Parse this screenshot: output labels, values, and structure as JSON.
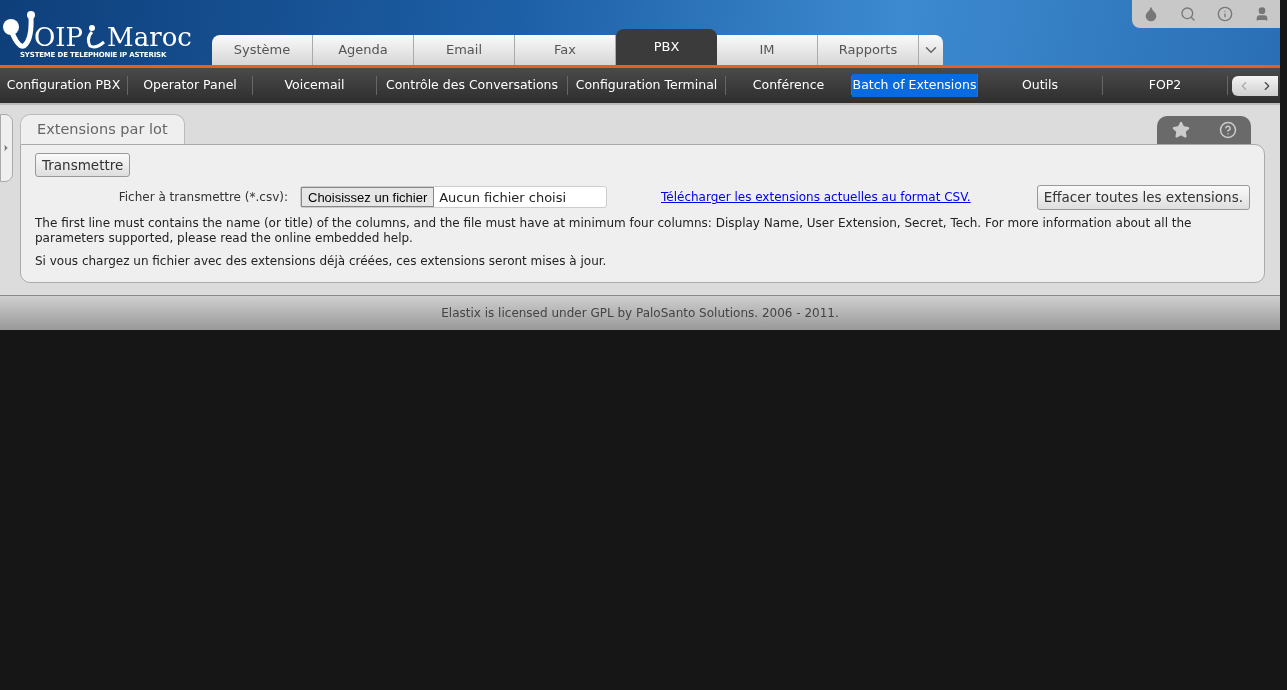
{
  "logo": {
    "brand": "OIP",
    "brand_suffix": "Maroc",
    "tagline": "SYSTEME DE TELEPHONIE IP ASTERISK"
  },
  "tabs": [
    {
      "label": "Système",
      "selected": false
    },
    {
      "label": "Agenda",
      "selected": false
    },
    {
      "label": "Email",
      "selected": false
    },
    {
      "label": "Fax",
      "selected": false
    },
    {
      "label": "PBX",
      "selected": true
    },
    {
      "label": "IM",
      "selected": false
    },
    {
      "label": "Rapports",
      "selected": false
    }
  ],
  "submenu": [
    {
      "label": "Configuration PBX",
      "selected": false
    },
    {
      "label": "Operator Panel",
      "selected": false
    },
    {
      "label": "Voicemail",
      "selected": false
    },
    {
      "label": "Contrôle des Conversations",
      "selected": false
    },
    {
      "label": "Configuration Terminal",
      "selected": false
    },
    {
      "label": "Conférence",
      "selected": false
    },
    {
      "label": "Batch of Extensions",
      "selected": true
    },
    {
      "label": "Outils",
      "selected": false
    },
    {
      "label": "FOP2",
      "selected": false
    }
  ],
  "panel": {
    "title": "Extensions par lot",
    "submit_button": "Transmettre",
    "file_label": "Ficher à transmettre (*.csv):",
    "file_button": "Choisissez un fichier",
    "file_status": "Aucun fichier choisi",
    "download_link": "Télécharger les extensions actuelles au format CSV.",
    "clear_button": "Effacer toutes les extensions.",
    "info_text": "The first line must contains the name (or title) of the columns, and the file must have at minimum four columns: Display Name, User Extension, Secret, Tech. For more information about all the parameters supported, please read the online embedded help.",
    "update_note": "Si vous chargez un fichier avec des extensions déjà créées, ces extensions seront mises à jour."
  },
  "footer": "Elastix is licensed under GPL by PaloSanto Solutions. 2006 - 2011."
}
